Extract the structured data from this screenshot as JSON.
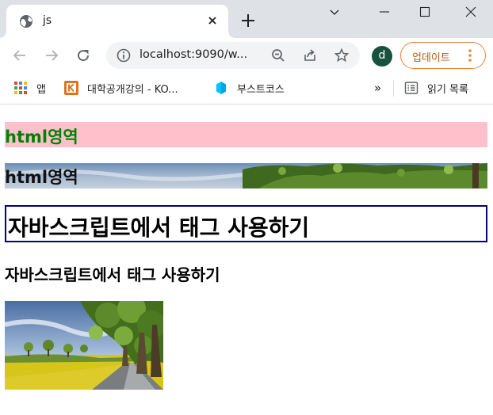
{
  "browser": {
    "tab_title": "js",
    "url": "localhost:9090/w...",
    "profile_initial": "d",
    "update_label": "업데이트",
    "bookmarks": [
      {
        "label": "앱",
        "icon": "apps-grid-icon"
      },
      {
        "label": "대학공개강의 - KO...",
        "icon": "kocw-icon"
      },
      {
        "label": "부스트코스",
        "icon": "boostcourse-icon"
      }
    ],
    "more_bookmarks": "»",
    "reading_list": "읽기 목록",
    "colors": {
      "tabstrip": "#dee1e6",
      "update_accent": "#e8853a",
      "avatar": "#17523f"
    }
  },
  "page": {
    "div1_text": "html영역",
    "div2_text": "html영역",
    "h1_text": "자바스크립트에서 태그 사용하기",
    "h3_text": "자바스크립트에서 태그 사용하기",
    "colors": {
      "div1_bg": "pink",
      "div1_text": "green",
      "h1_border": "navy"
    },
    "image": "tree-lined-road-photo"
  }
}
